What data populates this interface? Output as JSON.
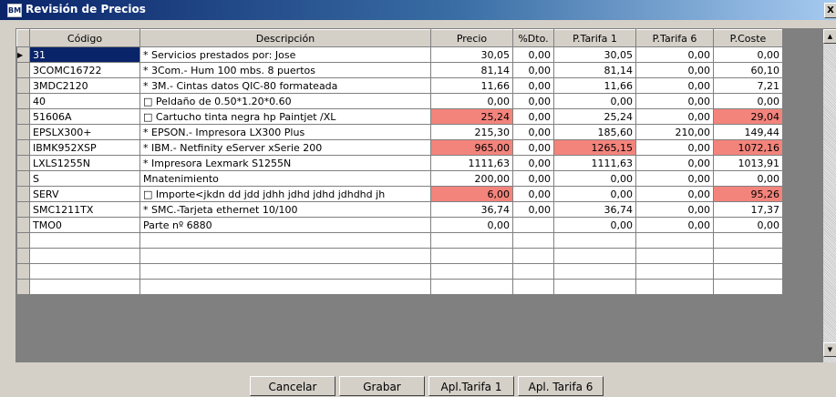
{
  "window": {
    "title": "Revisión de Precios",
    "app_icon": "app-icon",
    "close_glyph": "X"
  },
  "grid": {
    "columns": [
      "Código",
      "Descripción",
      "Precio",
      "%Dto.",
      "P.Tarifa 1",
      "P.Tarifa 6",
      "P.Coste"
    ],
    "highlight_color": "#f3847c",
    "selected_color": "#0a246a",
    "current_row": 0,
    "rows": [
      {
        "cells": [
          "31",
          "* Servicios prestados por: Jose",
          "30,05",
          "0,00",
          "30,05",
          "0,00",
          "0,00"
        ],
        "hl": []
      },
      {
        "cells": [
          "3COMC16722",
          "* 3Com.- Hum 100 mbs. 8 puertos",
          "81,14",
          "0,00",
          "81,14",
          "0,00",
          "60,10"
        ],
        "hl": []
      },
      {
        "cells": [
          "3MDC2120",
          "* 3M.- Cintas datos QIC-80 formateada",
          "11,66",
          "0,00",
          "11,66",
          "0,00",
          "7,21"
        ],
        "hl": []
      },
      {
        "cells": [
          "40",
          "□ Peldaño de 0.50*1.20*0.60",
          "0,00",
          "0,00",
          "0,00",
          "0,00",
          "0,00"
        ],
        "hl": []
      },
      {
        "cells": [
          "51606A",
          "□ Cartucho tinta negra hp Paintjet /XL",
          "25,24",
          "0,00",
          "25,24",
          "0,00",
          "29,04"
        ],
        "hl": [
          2,
          6
        ]
      },
      {
        "cells": [
          "EPSLX300+",
          "* EPSON.- Impresora LX300 Plus",
          "215,30",
          "0,00",
          "185,60",
          "210,00",
          "149,44"
        ],
        "hl": []
      },
      {
        "cells": [
          "IBMK952XSP",
          "* IBM.- Netfinity eServer xSerie 200",
          "965,00",
          "0,00",
          "1265,15",
          "0,00",
          "1072,16"
        ],
        "hl": [
          2,
          4,
          6
        ]
      },
      {
        "cells": [
          "LXLS1255N",
          "* Impresora Lexmark S1255N",
          "1111,63",
          "0,00",
          "1111,63",
          "0,00",
          "1013,91"
        ],
        "hl": []
      },
      {
        "cells": [
          "S",
          "Mnatenimiento",
          "200,00",
          "0,00",
          "0,00",
          "0,00",
          "0,00"
        ],
        "hl": []
      },
      {
        "cells": [
          "SERV",
          "□ Importe<jkdn dd jdd jdhh jdhd jdhd jdhdhd jh",
          "6,00",
          "0,00",
          "0,00",
          "0,00",
          "95,26"
        ],
        "hl": [
          2,
          6
        ]
      },
      {
        "cells": [
          "SMC1211TX",
          "* SMC.-Tarjeta ethernet 10/100",
          "36,74",
          "0,00",
          "36,74",
          "0,00",
          "17,37"
        ],
        "hl": []
      },
      {
        "cells": [
          "TMO0",
          "Parte nº 6880",
          "0,00",
          "",
          "0,00",
          "0,00",
          "0,00"
        ],
        "hl": []
      }
    ],
    "empty_rows": 4
  },
  "buttons": {
    "cancel": "Cancelar",
    "save": "Grabar",
    "apply_tarifa1": "Apl.Tarifa 1",
    "apply_tarifa6": "Apl. Tarifa 6"
  }
}
